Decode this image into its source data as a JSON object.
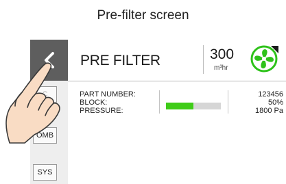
{
  "caption": "Pre-filter screen",
  "header": {
    "title": "PRE FILTER",
    "flow_value": "300",
    "flow_unit": "m³hr"
  },
  "sidebar": {
    "buttons": [
      {
        "label": "C"
      },
      {
        "label": "OMB"
      },
      {
        "label": "SYS"
      }
    ]
  },
  "rows": [
    {
      "label": "PART NUMBER:",
      "value": "123456"
    },
    {
      "label": "BLOCK:",
      "value": "50%"
    },
    {
      "label": "PRESSURE:",
      "value": "1800 Pa"
    }
  ],
  "block_level": 0.5,
  "colors": {
    "accent_green": "#3fcc18",
    "back_button": "#5e5e5e",
    "fan_circle": "#2ec21a"
  },
  "icons": [
    "back-arrow-icon",
    "fan-icon",
    "pointing-hand-icon"
  ]
}
